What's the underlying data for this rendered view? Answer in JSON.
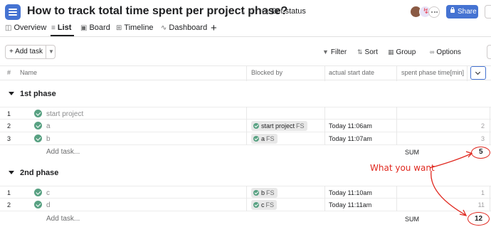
{
  "header": {
    "title": "How to track total time spent per project phase?",
    "set_status": "Set status",
    "share_label": "Share"
  },
  "tabs": [
    {
      "label": "Overview",
      "icon": "overview-icon"
    },
    {
      "label": "List",
      "icon": "list-icon",
      "active": true
    },
    {
      "label": "Board",
      "icon": "board-icon"
    },
    {
      "label": "Timeline",
      "icon": "timeline-icon"
    },
    {
      "label": "Dashboard",
      "icon": "dashboard-icon"
    }
  ],
  "toolbar": {
    "add_task": "+ Add task",
    "filter": "Filter",
    "sort": "Sort",
    "group": "Group",
    "options": "Options"
  },
  "columns": {
    "num": "#",
    "name": "Name",
    "blocked_by": "Blocked by",
    "start_date": "actual start date",
    "spent": "spent phase time[min]"
  },
  "sections": [
    {
      "title": "1st phase",
      "tasks": [
        {
          "num": "1",
          "name": "start project",
          "blocked_by": "",
          "blocked_type": "",
          "start": "",
          "spent": ""
        },
        {
          "num": "2",
          "name": "a",
          "blocked_by": "start project",
          "blocked_type": "FS",
          "start": "Today 11:06am",
          "spent": "2"
        },
        {
          "num": "3",
          "name": "b",
          "blocked_by": "a",
          "blocked_type": "FS",
          "start": "Today 11:07am",
          "spent": "3"
        }
      ],
      "add_task": "Add task...",
      "sum_label": "SUM",
      "sum_value": "5"
    },
    {
      "title": "2nd phase",
      "tasks": [
        {
          "num": "1",
          "name": "c",
          "blocked_by": "b",
          "blocked_type": "FS",
          "start": "Today 11:10am",
          "spent": "1"
        },
        {
          "num": "2",
          "name": "d",
          "blocked_by": "c",
          "blocked_type": "FS",
          "start": "Today 11:11am",
          "spent": "11"
        }
      ],
      "add_task": "Add task...",
      "sum_label": "SUM",
      "sum_value": "12"
    }
  ],
  "annotation": {
    "text": "What you want",
    "color": "#e0281f"
  },
  "colors": {
    "accent": "#4573d2",
    "complete": "#58a182"
  }
}
